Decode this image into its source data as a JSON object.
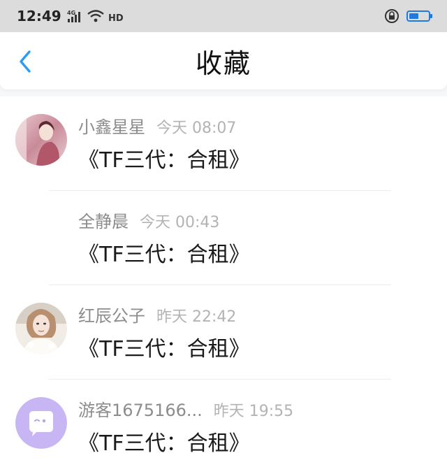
{
  "status_bar": {
    "time": "12:49",
    "network": "4G",
    "hd": "HD",
    "battery_level": 0.48,
    "accent": "#1f7ae0"
  },
  "header": {
    "title": "收藏",
    "back_icon": "chevron-left-icon",
    "back_color": "#2b9bf4"
  },
  "items": [
    {
      "name": "小鑫星星",
      "time": "今天 08:07",
      "title": "《TF三代：合租》",
      "avatar": "photo"
    },
    {
      "name": "全静晨",
      "time": "今天 00:43",
      "title": "《TF三代：合租》",
      "avatar": "none"
    },
    {
      "name": "红辰公子",
      "time": "昨天 22:42",
      "title": "《TF三代：合租》",
      "avatar": "photo"
    },
    {
      "name": "游客1675166...",
      "time": "昨天 19:55",
      "title": "《TF三代：合租》",
      "avatar": "chat-bubble-icon"
    }
  ]
}
